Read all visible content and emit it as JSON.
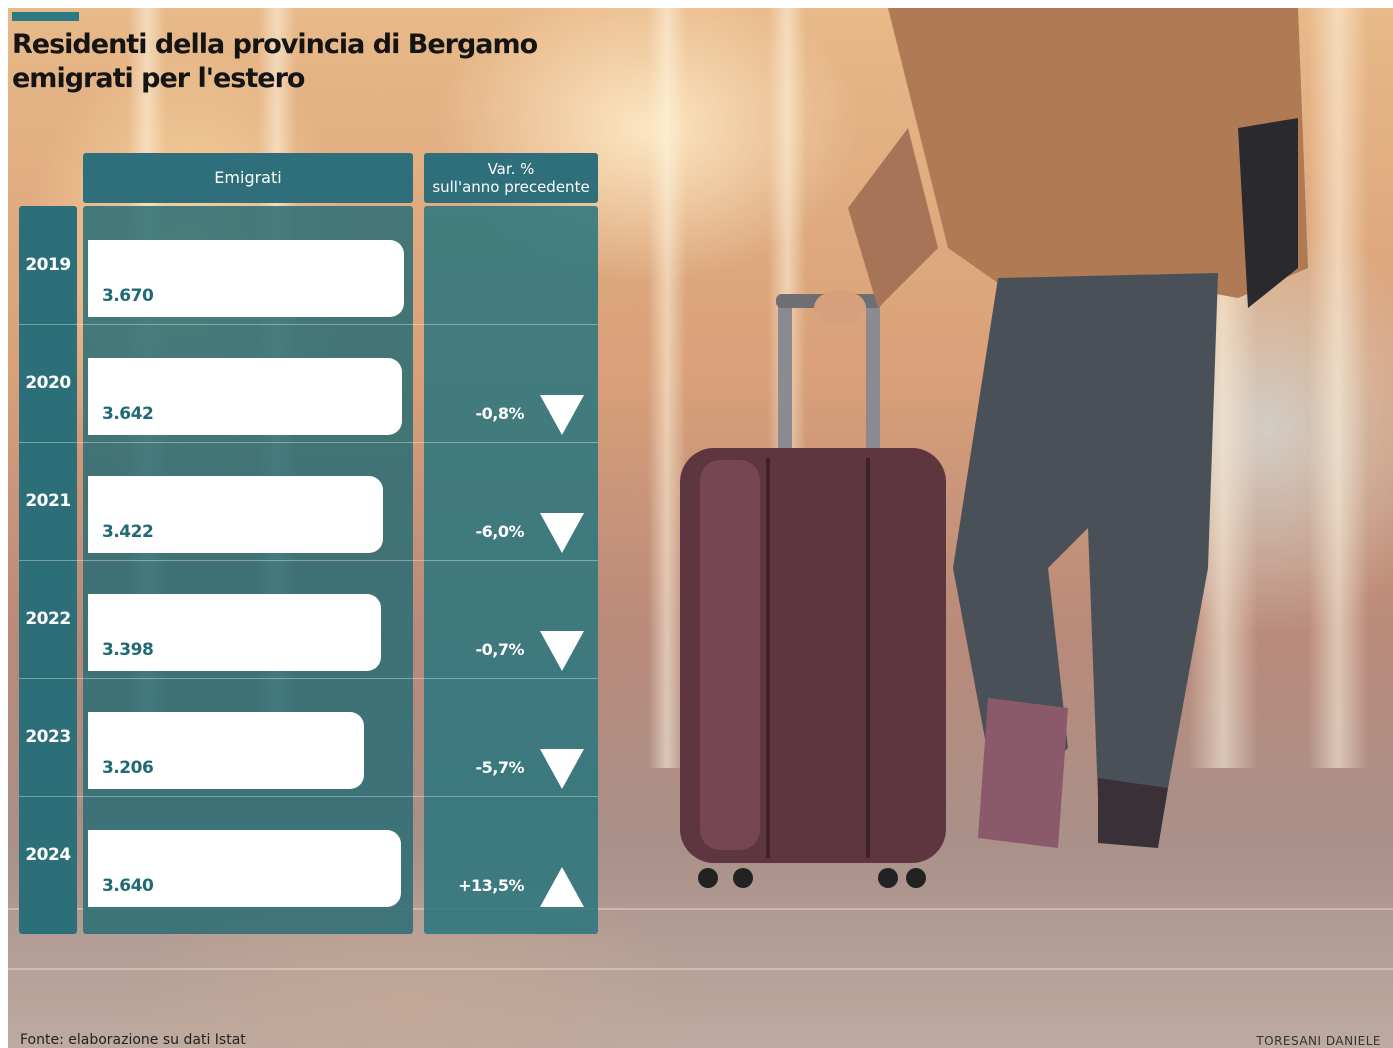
{
  "header": {
    "title_line1": "Residenti della provincia di Bergamo",
    "title_line2": "emigrati per l'estero",
    "col_emigrati": "Emigrati",
    "col_var_line1": "Var. %",
    "col_var_line2": "sull'anno precedente"
  },
  "chart_data": {
    "type": "bar",
    "title": "Residenti della provincia di Bergamo emigrati per l'estero",
    "categories": [
      "2019",
      "2020",
      "2021",
      "2022",
      "2023",
      "2024"
    ],
    "series": [
      {
        "name": "Emigrati",
        "values": [
          3670,
          3642,
          3422,
          3398,
          3206,
          3640
        ]
      }
    ],
    "value_labels": [
      "3.670",
      "3.642",
      "3.422",
      "3.398",
      "3.206",
      "3.640"
    ],
    "variation": [
      "",
      "-0,8%",
      "-6,0%",
      "-0,7%",
      "-5,7%",
      "+13,5%"
    ],
    "variation_direction": [
      "",
      "down",
      "down",
      "down",
      "down",
      "up"
    ]
  },
  "footer": {
    "source": "Fonte: elaborazione su dati Istat",
    "credit": "TORESANI DANIELE"
  },
  "colors": {
    "teal_header": "#2f6f7b",
    "teal_panel": "#2c6f78",
    "bar": "#ffffff",
    "value_text": "#1f6a73"
  }
}
